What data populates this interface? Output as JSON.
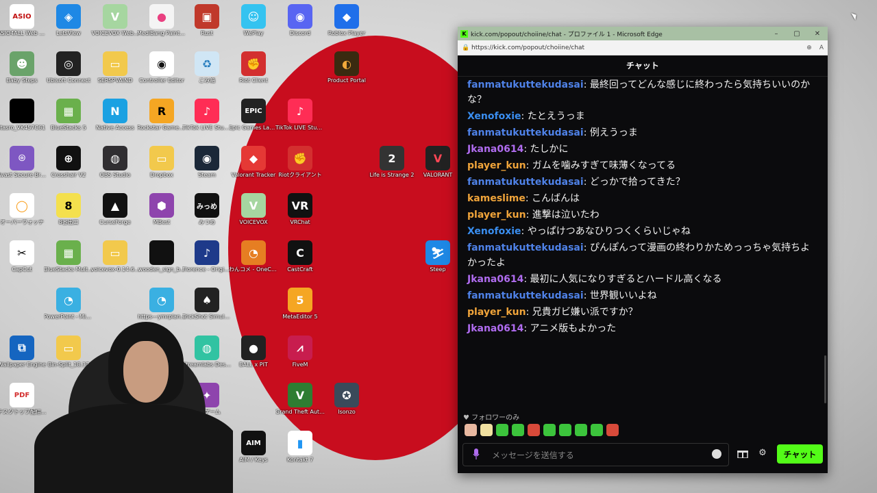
{
  "desktop": {
    "icons": [
      {
        "label": "ASIO4ALL Web Site",
        "glyph": "ASIO",
        "color": "#ffffff",
        "text_color": "#c01010"
      },
      {
        "label": "LetsView",
        "glyph": "◈",
        "color": "#1e88e5"
      },
      {
        "label": "VOICEVOX Web...",
        "glyph": "V",
        "color": "#a6d6a0"
      },
      {
        "label": "MediBang Paint Pro",
        "glyph": "●",
        "color": "#f4f4f4",
        "text_color": "#e94080"
      },
      {
        "label": "Rust",
        "glyph": "▣",
        "color": "#c0392b"
      },
      {
        "label": "WePlay",
        "glyph": "☺",
        "color": "#35c3f0"
      },
      {
        "label": "Discord",
        "glyph": "◉",
        "color": "#5865f2"
      },
      {
        "label": "Roblox Player",
        "glyph": "◆",
        "color": "#1f6fea"
      },
      {
        "label": "Baby Steps",
        "glyph": "☻",
        "color": "#6aa36a"
      },
      {
        "label": "Ubisoft Connect",
        "glyph": "◎",
        "color": "#222222"
      },
      {
        "label": "SERSPVAIND",
        "glyph": "▭",
        "color": "#f2c94c"
      },
      {
        "label": "Controller Editor",
        "glyph": "◉",
        "color": "#ffffff",
        "text_color": "#111111"
      },
      {
        "label": "ごみ箱",
        "glyph": "♻",
        "color": "#d0e6f5",
        "text_color": "#2a7fbf"
      },
      {
        "label": "Riot Client",
        "glyph": "✊",
        "color": "#d32f2f"
      },
      {
        "label": "Product Portal",
        "glyph": "◐",
        "color": "#3a2a10",
        "text_color": "#f2a93b"
      },
      {
        "label": "Itasro_VK457C61",
        "glyph": "",
        "color": "#000000"
      },
      {
        "label": "BlueStacks 5",
        "glyph": "▦",
        "color": "#6ab04c"
      },
      {
        "label": "Native Access",
        "glyph": "N",
        "color": "#1ba1e2"
      },
      {
        "label": "Rockstar Games Launcher",
        "glyph": "R",
        "color": "#f5a623",
        "text_color": "#000000"
      },
      {
        "label": "TikTok LIVE Studio",
        "glyph": "♪",
        "color": "#ff2d55"
      },
      {
        "label": "Epic Games Launcher",
        "glyph": "EPIC",
        "color": "#222222"
      },
      {
        "label": "TikTok LIVE Studio",
        "glyph": "♪",
        "color": "#ff2d55"
      },
      {
        "label": "Avast Secure Browser",
        "glyph": "⌾",
        "color": "#7e57c2"
      },
      {
        "label": "Crosshair V2",
        "glyph": "⊕",
        "color": "#111111"
      },
      {
        "label": "OBS Studio",
        "glyph": "◍",
        "color": "#302e31"
      },
      {
        "label": "Dropbox",
        "glyph": "▭",
        "color": "#f2c94c"
      },
      {
        "label": "Steam",
        "glyph": "◉",
        "color": "#1b2838"
      },
      {
        "label": "Valorant Tracker",
        "glyph": "◆",
        "color": "#e53935"
      },
      {
        "label": "Riotクライアント",
        "glyph": "✊",
        "color": "#d32f2f"
      },
      {
        "label": "Life is Strange 2",
        "glyph": "2",
        "color": "#333333"
      },
      {
        "label": "VALORANT",
        "glyph": "V",
        "color": "#222222",
        "text_color": "#ff4655"
      },
      {
        "label": "オーバーウォッチ",
        "glyph": "◯",
        "color": "#ffffff",
        "text_color": "#f99e1a"
      },
      {
        "label": "8番出口",
        "glyph": "8",
        "color": "#f4e04d",
        "text_color": "#000000"
      },
      {
        "label": "CurseForge",
        "glyph": "▲",
        "color": "#111111"
      },
      {
        "label": "MBest",
        "glyph": "⬢",
        "color": "#8e44ad"
      },
      {
        "label": "みつめ",
        "glyph": "みっめ",
        "color": "#111111"
      },
      {
        "label": "VOICEVOX",
        "glyph": "V",
        "color": "#a6d6a0"
      },
      {
        "label": "VRChat",
        "glyph": "VR",
        "color": "#111111"
      },
      {
        "label": "CapCut",
        "glyph": "✂",
        "color": "#ffffff",
        "text_color": "#000000"
      },
      {
        "label": "BlueStacks Multi-Instance Manager",
        "glyph": "▦",
        "color": "#6ab04c"
      },
      {
        "label": "voicevox-0.14.6...",
        "glyph": "▭",
        "color": "#f2c94c"
      },
      {
        "label": "wooden_sign_b...",
        "glyph": "",
        "color": "#111111"
      },
      {
        "label": "Florence - Original S...",
        "glyph": "♪",
        "color": "#1e3a8a"
      },
      {
        "label": "わんコメ - OneComme",
        "glyph": "◔",
        "color": "#e67e22"
      },
      {
        "label": "CastCraft",
        "glyph": "C",
        "color": "#111111"
      },
      {
        "label": "Steep",
        "glyph": "⛷",
        "color": "#1e88e5"
      },
      {
        "label": "PowerPoint - Microsoft 365",
        "glyph": "◔",
        "color": "#3ab0e2"
      },
      {
        "label": "https---ymrplan...",
        "glyph": "◔",
        "color": "#3ab0e2"
      },
      {
        "label": "TrickShot Simulator",
        "glyph": "♠",
        "color": "#222222"
      },
      {
        "label": "MetaEditor 5",
        "glyph": "5",
        "color": "#f5a623"
      },
      {
        "label": "Wallpaper Engine",
        "glyph": "⧉",
        "color": "#1565c0"
      },
      {
        "label": "Bin-Split_18.37",
        "glyph": "▭",
        "color": "#f2c94c"
      },
      {
        "label": "Streamlabs Desktop",
        "glyph": "◍",
        "color": "#31c3a2"
      },
      {
        "label": "BALL x PIT",
        "glyph": "●",
        "color": "#222222"
      },
      {
        "label": "FiveM",
        "glyph": "⩘",
        "color": "#c81d4e"
      },
      {
        "label": "デスクトップ配信用素材_0S",
        "glyph": "PDF",
        "color": "#ffffff",
        "text_color": "#d32f2f"
      },
      {
        "label": "人狼ゲーム",
        "glyph": "✦",
        "color": "#8e44ad"
      },
      {
        "label": "Grand Theft Auto V",
        "glyph": "V",
        "color": "#2e7d32"
      },
      {
        "label": "Isonzo",
        "glyph": "✪",
        "color": "#3a4a5a"
      },
      {
        "label": "Studio",
        "glyph": "◻",
        "color": "#111111"
      },
      {
        "label": "AIM / Keys",
        "glyph": "AIM",
        "color": "#111111"
      },
      {
        "label": "Kontakt 7",
        "glyph": "▮",
        "color": "#ffffff",
        "text_color": "#2196f3"
      }
    ]
  },
  "browser": {
    "title": "kick.com/popout/choiine/chat - プロファイル 1 - Microsoft Edge",
    "url": "https://kick.com/popout/choiine/chat",
    "brand_color": "#53fc18"
  },
  "chat": {
    "header": "チャット",
    "messages": [
      {
        "user": "fanmatukuttekudasai",
        "color": "#4f82e8",
        "text": "最終回ってどんな感じに終わったら気持ちいいのかな？"
      },
      {
        "user": "Xenofoxie",
        "color": "#3a8ef0",
        "text": "たとえうっま"
      },
      {
        "user": "fanmatukuttekudasai",
        "color": "#4f82e8",
        "text": "例えうっま"
      },
      {
        "user": "Jkana0614",
        "color": "#b06cf0",
        "text": "たしかに"
      },
      {
        "user": "player_kun",
        "color": "#f0a43a",
        "text": "ガムを噛みすぎて味薄くなってる"
      },
      {
        "user": "fanmatukuttekudasai",
        "color": "#4f82e8",
        "text": "どっかで拾ってきた？"
      },
      {
        "user": "kameslime",
        "color": "#f0a43a",
        "text": "こんばんは"
      },
      {
        "user": "player_kun",
        "color": "#f0a43a",
        "text": "進撃は泣いたわ"
      },
      {
        "user": "Xenofoxie",
        "color": "#3a8ef0",
        "text": "やっぱけつあなひりつくくらいじゃね"
      },
      {
        "user": "fanmatukuttekudasai",
        "color": "#4f82e8",
        "text": "ぴんぽんって漫画の終わりかためっっちゃ気持ちよかったよ"
      },
      {
        "user": "Jkana0614",
        "color": "#b06cf0",
        "text": "最初に人気になりすぎるとハードル高くなる"
      },
      {
        "user": "fanmatukuttekudasai",
        "color": "#4f82e8",
        "text": "世界観いいよね"
      },
      {
        "user": "player_kun",
        "color": "#f0a43a",
        "text": "兄貴ガビ嫌い派ですか？"
      },
      {
        "user": "Jkana0614",
        "color": "#b06cf0",
        "text": "アニメ版もよかった"
      }
    ],
    "followers_only": "フォロワーのみ",
    "emotes": [
      "#e8b8a0",
      "#f0e0a0",
      "#3cc43c",
      "#3cc43c",
      "#d84a3a",
      "#3cc43c",
      "#3cc43c",
      "#3cc43c",
      "#3cc43c",
      "#d84a3a"
    ],
    "input_placeholder": "メッセージを送信する",
    "send_label": "チャット"
  }
}
